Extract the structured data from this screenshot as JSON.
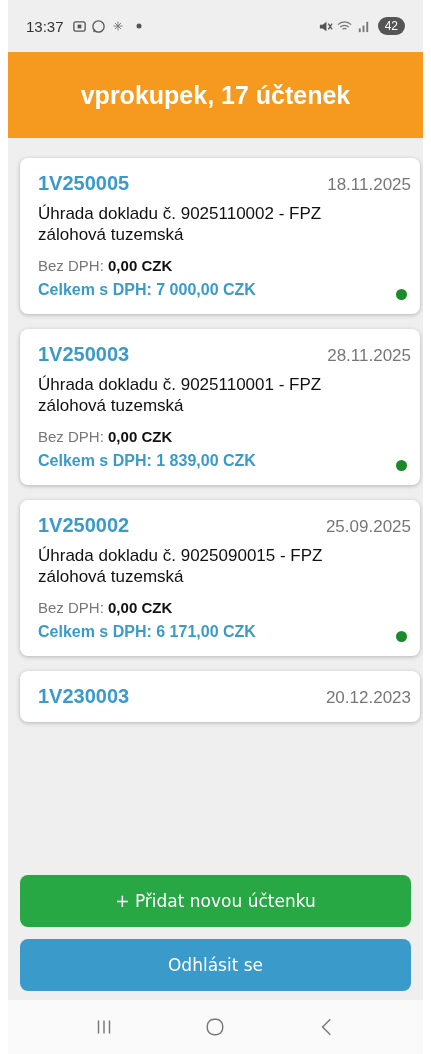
{
  "status_bar": {
    "time": "13:37",
    "battery": "42"
  },
  "header": {
    "title": "vprokupek, 17 účtenek"
  },
  "receipts": [
    {
      "number": "1V250005",
      "date": "18.11.2025",
      "description": "Úhrada dokladu č. 9025110002 - FPZ zálohová tuzemská",
      "net": "Bez DPH: **0,00 CZK**",
      "total": "Celkem s DPH: 7 000,00 CZK",
      "color": "#1a8a2a"
    },
    {
      "number": "1V250003",
      "date": "28.11.2025",
      "description": "Úhrada dokladu č. 9025110001 - FPZ zálohová tuzemská",
      "net": "Bez DPH: **0,00 CZK**",
      "total": "Celkem s DPH: 1 839,00 CZK",
      "color": "#1a8a2a"
    },
    {
      "number": "1V250002",
      "date": "25.09.2025",
      "description": "Úhrada dokladu č. 9025090015 - FPZ zálohová tuzemská",
      "net": "Bez DPH: **0,00 CZK**",
      "total": "Celkem s DPH: 6 171,00 CZK",
      "color": "#1a8a2a"
    },
    {
      "number": "1V230003",
      "date": "20.12.2023"
    }
  ],
  "buttons": [
    {
      "kind": "add",
      "label": "+ Přidat novou účtenku"
    },
    {
      "kind": "logout",
      "label": "Odhlásit se"
    }
  ]
}
